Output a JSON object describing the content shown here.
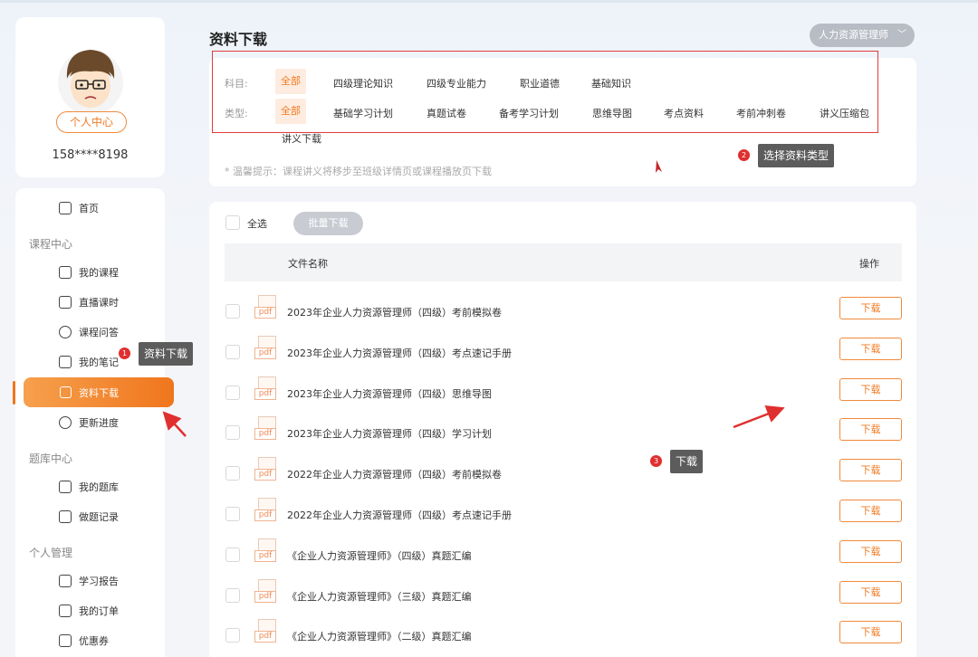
{
  "profile": {
    "center_label": "个人中心",
    "phone": "158****8198"
  },
  "sidebar": {
    "home": "首页",
    "group_course": "课程中心",
    "my_courses": "我的课程",
    "live_hours": "直播课时",
    "course_qa": "课程问答",
    "my_notes": "我的笔记",
    "download": "资料下载",
    "update_progress": "更新进度",
    "group_bank": "题库中心",
    "my_bank": "我的题库",
    "practice_records": "做题记录",
    "group_personal": "个人管理",
    "study_report": "学习报告",
    "my_orders": "我的订单",
    "coupons": "优惠券"
  },
  "header": {
    "title": "资料下载",
    "role_select": "人力资源管理师"
  },
  "filters": {
    "subject_label": "科目:",
    "subject_options": [
      "全部",
      "四级理论知识",
      "四级专业能力",
      "职业道德",
      "基础知识"
    ],
    "type_label": "类型:",
    "type_options": [
      "全部",
      "基础学习计划",
      "真题试卷",
      "备考学习计划",
      "思维导图",
      "考点资料",
      "考前冲刺卷",
      "讲义压缩包",
      "讲义下载"
    ],
    "tip": "* 温馨提示：课程讲义将移步至班级详情页或课程播放页下载"
  },
  "list": {
    "select_all": "全选",
    "batch_download": "批量下载",
    "col_name": "文件名称",
    "col_action": "操作",
    "file_tag": "pdf",
    "download_label": "下载",
    "rows": [
      "2023年企业人力资源管理师（四级）考前模拟卷",
      "2023年企业人力资源管理师（四级）考点速记手册",
      "2023年企业人力资源管理师（四级）思维导图",
      "2023年企业人力资源管理师（四级）学习计划",
      "2022年企业人力资源管理师（四级）考前模拟卷",
      "2022年企业人力资源管理师（四级）考点速记手册",
      "《企业人力资源管理师》（四级）真题汇编",
      "《企业人力资源管理师》（三级）真题汇编",
      "《企业人力资源管理师》（二级）真题汇编"
    ]
  },
  "annotations": {
    "step1_num": "1",
    "step1_text": "资料下载",
    "step2_num": "2",
    "step2_text": "选择资料类型",
    "step3_num": "3",
    "step3_text": "下载"
  },
  "colors": {
    "accent": "#f07a22",
    "annotation_red": "#e02f2f",
    "callout_bg": "#5c5c5c"
  }
}
